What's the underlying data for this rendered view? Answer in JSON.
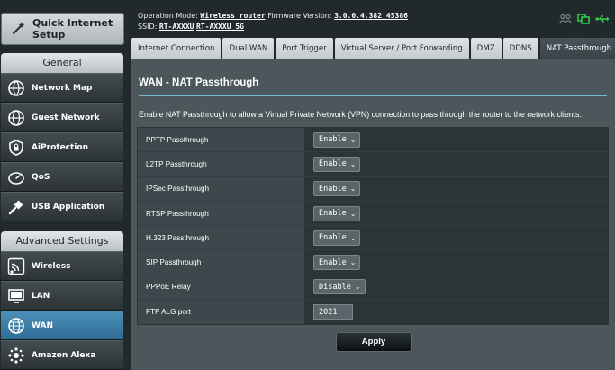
{
  "sidebar": {
    "quick_setup": "Quick Internet Setup",
    "general_heading": "General",
    "general_items": [
      {
        "label": "Network Map",
        "icon": "network-map-icon"
      },
      {
        "label": "Guest Network",
        "icon": "globe-icon"
      },
      {
        "label": "AiProtection",
        "icon": "lock-icon"
      },
      {
        "label": "QoS",
        "icon": "speedometer-icon"
      },
      {
        "label": "USB Application",
        "icon": "usb-icon"
      }
    ],
    "advanced_heading": "Advanced Settings",
    "advanced_items": [
      {
        "label": "Wireless",
        "icon": "wifi-icon"
      },
      {
        "label": "LAN",
        "icon": "monitor-icon"
      },
      {
        "label": "WAN",
        "icon": "globe-icon",
        "active": true
      },
      {
        "label": "Amazon Alexa",
        "icon": "alexa-icon"
      }
    ]
  },
  "header": {
    "mode_label": "Operation Mode:",
    "mode_value": "Wireless router",
    "firmware_label": "Firmware Version:",
    "firmware_value": "3.0.0.4.382_45386",
    "ssid_label": "SSID:",
    "ssid_1": "RT-AXXXU",
    "ssid_2": "RT-AXXXU_5G"
  },
  "tabs": [
    {
      "label": "Internet Connection"
    },
    {
      "label": "Dual WAN"
    },
    {
      "label": "Port Trigger"
    },
    {
      "label": "Virtual Server / Port Forwarding"
    },
    {
      "label": "DMZ"
    },
    {
      "label": "DDNS"
    },
    {
      "label": "NAT Passthrough",
      "active": true
    }
  ],
  "main": {
    "title": "WAN - NAT Passthrough",
    "description": "Enable NAT Passthrough to allow a Virtual Private Network (VPN) connection to pass through the router to the network clients.",
    "rows": [
      {
        "label": "PPTP Passthrough",
        "value": "Enable"
      },
      {
        "label": "L2TP Passthrough",
        "value": "Enable"
      },
      {
        "label": "IPSec Passthrough",
        "value": "Enable"
      },
      {
        "label": "RTSP Passthrough",
        "value": "Enable"
      },
      {
        "label": "H.323 Passthrough",
        "value": "Enable"
      },
      {
        "label": "SIP Passthrough",
        "value": "Enable"
      },
      {
        "label": "PPPoE Relay",
        "value": "Disable"
      },
      {
        "label": "FTP ALG port",
        "value": "2021",
        "type": "text"
      }
    ],
    "apply_label": "Apply"
  },
  "colors": {
    "accent": "#4d8fb8",
    "status_green": "#2fd34a",
    "panel": "#4c575c"
  }
}
